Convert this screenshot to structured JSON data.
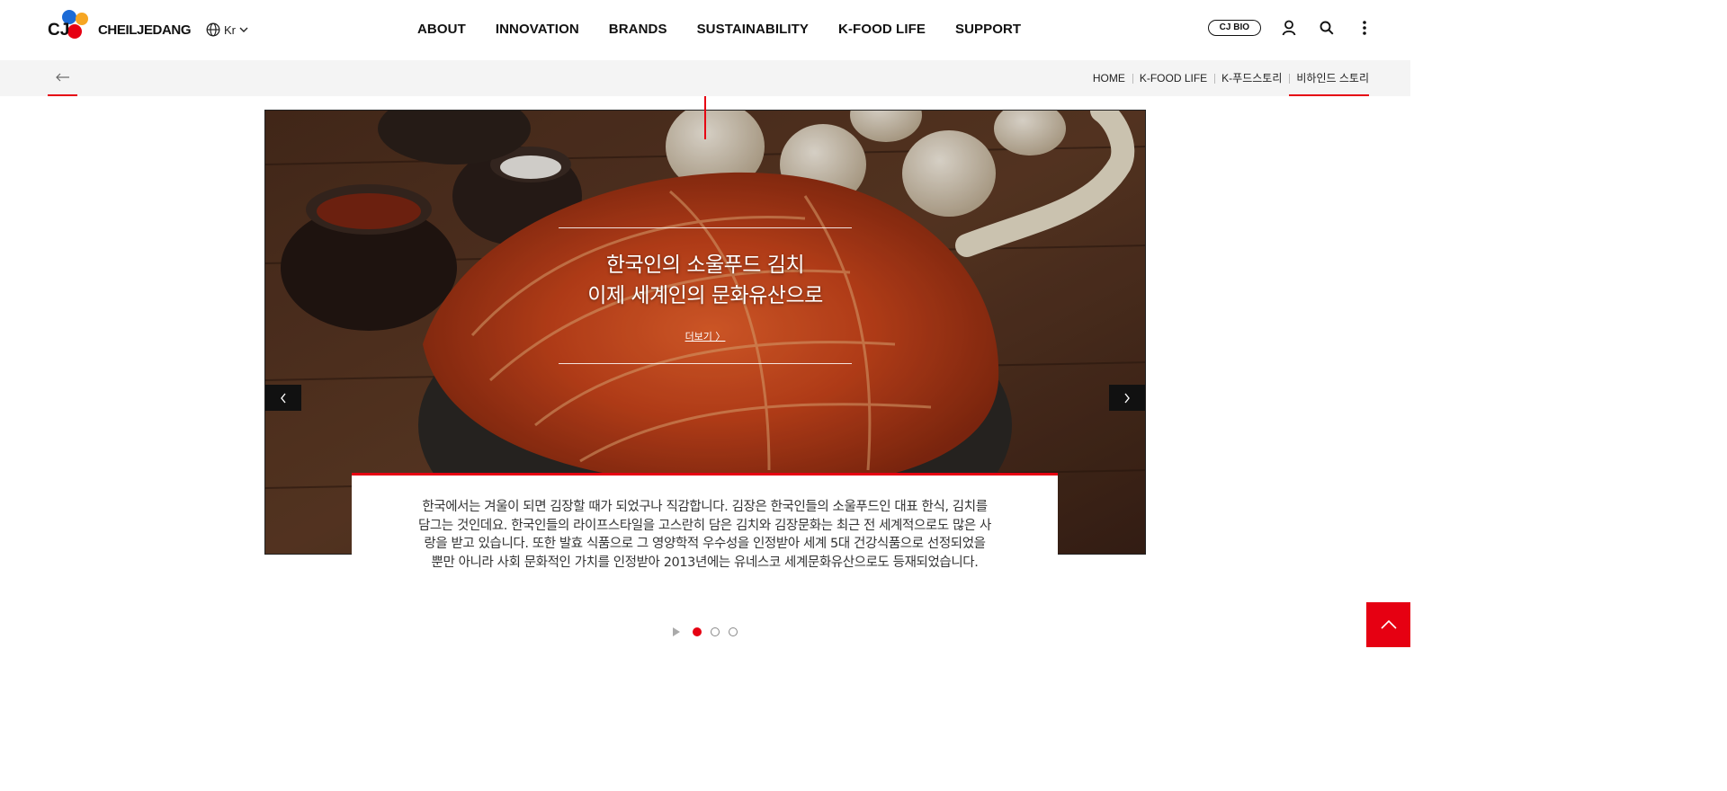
{
  "header": {
    "logo_cj": "CJ",
    "logo_brand": "CHEILJEDANG",
    "lang_label": "Kr",
    "nav": [
      "ABOUT",
      "INNOVATION",
      "BRANDS",
      "SUSTAINABILITY",
      "K-FOOD LIFE",
      "SUPPORT"
    ],
    "cjbio_label": "CJ BIO"
  },
  "breadcrumb": [
    "HOME",
    "K-FOOD LIFE",
    "K-푸드스토리",
    "비하인드 스토리"
  ],
  "slide": {
    "title_line1": "한국인의 소울푸드 김치",
    "title_line2": "이제 세계인의 문화유산으로",
    "more_label": "더보기 〉",
    "description": "한국에서는 겨울이 되면 김장할 때가 되었구나 직감합니다. 김장은 한국인들의 소울푸드인 대표 한식, 김치를 담그는 것인데요. 한국인들의 라이프스타일을 고스란히 담은 김치와 김장문화는 최근 전 세계적으로도 많은 사랑을 받고 있습니다. 또한 발효 식품으로 그 영양학적 우수성을 인정받아 세계 5대 건강식품으로 선정되었을 뿐만 아니라 사회 문화적인 가치를 인정받아 2013년에는 유네스코 세계문화유산으로도 등재되었습니다."
  },
  "pagination": {
    "total": 3,
    "active": 1
  },
  "colors": {
    "accent": "#e60012",
    "text": "#222222",
    "loc_bar": "#f4f4f4"
  }
}
